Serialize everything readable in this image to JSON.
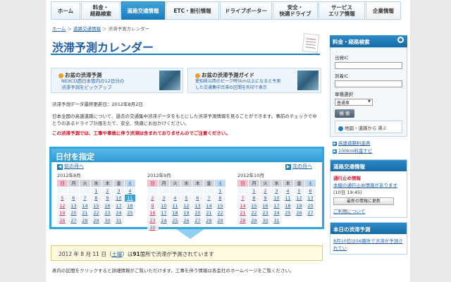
{
  "nav": {
    "items": [
      {
        "label": "ホーム"
      },
      {
        "label": "料金・\n経路検索"
      },
      {
        "label": "道路交通情報"
      },
      {
        "label": "ETC・割引情報"
      },
      {
        "label": "ドライブポーター"
      },
      {
        "label": "安全・\n快適ドライブ"
      },
      {
        "label": "サービス\nエリア情報"
      },
      {
        "label": "企業情報"
      }
    ]
  },
  "breadcrumb": {
    "home": "ホーム",
    "sep": "＞",
    "traffic": "道路交通情報",
    "current": "渋滞予測カレンダー"
  },
  "title": "渋滞予測カレンダー",
  "banners": [
    {
      "title": "お盆の渋滞予測",
      "desc1": "NEXCO西日本管内の12日分の",
      "desc2": "渋滞予測をピックアップ"
    },
    {
      "title": "お盆の渋滞予測ガイド",
      "desc1": "愛知県以西のピーク時5km以上になると予測",
      "desc2": "した交通集中渋滞の区間を矢印で表示"
    }
  ],
  "update": "渋滞予測データ最終更新日：2012年8月2日",
  "description": "日本全国の高速道路について、過去の交通集中渋滞データをもとにした渋滞予測情報を見ることができます。事前のチェックでゆとりのあるドライブ計画をたて、安全、快適にお出かけください。",
  "warning": "この渋滞予測では、工事や事故に伴う渋滞は含まれておりませんのでご注意ください。",
  "calendar": {
    "header": "日付を指定",
    "prev": "前の月へ",
    "next": "次の月へ",
    "weekdays": [
      "日",
      "月",
      "火",
      "水",
      "木",
      "金",
      "土"
    ],
    "months": [
      {
        "title": "2012年8月",
        "offset": 3,
        "days": 31,
        "selected": 11
      },
      {
        "title": "2012年9月",
        "offset": 6,
        "days": 30,
        "selected": 0
      },
      {
        "title": "2012年10月",
        "offset": 1,
        "days": 31,
        "selected": 0
      }
    ]
  },
  "result": {
    "pre": "2012 年 8 月 11 日（",
    "day": "土曜",
    "mid": "）は",
    "count": "91",
    "post": "箇所で渋滞が予測されています"
  },
  "note": "表内の区間をクリックすると詳細情報がご覧いただけます。工事を伴う情報は各会社のホームページをご覧ください。",
  "sidebar": {
    "search_title": "料金・経路検索",
    "from_label": "出発IC",
    "to_label": "到着IC",
    "vehicle_label": "車種選択",
    "vehicle_value": "普通車",
    "search_btn": "検 索",
    "map_link": "地図・道路から",
    "map_link2": "選ぶ",
    "link1": "高速道路料金表",
    "link2": "100km料金ナビ",
    "traffic_title": "道路交通情報",
    "closure_title": "通行止め情報",
    "closure_text": "本線の通行止め情報があります",
    "closure_time": "(10日 19:45)",
    "update_btn": "最新の情報に更新",
    "usage": "ご利用について",
    "today_title": "本日の渋滞予測",
    "today_text": "8月10日は56箇所で渋滞が予測されてい"
  }
}
